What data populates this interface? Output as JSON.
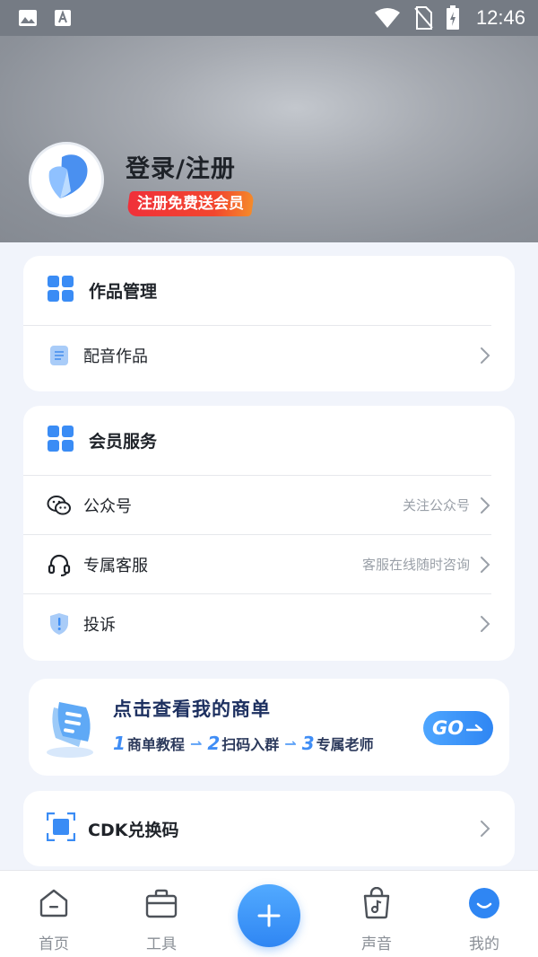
{
  "status_bar": {
    "time": "12:46",
    "icons_left": [
      "gallery-icon",
      "font-icon"
    ],
    "icons_right": [
      "wifi-icon",
      "no-sim-icon",
      "battery-charging-icon"
    ]
  },
  "profile": {
    "login_label": "登录/注册",
    "badge_label": "注册免费送会员"
  },
  "works_card": {
    "title": "作品管理",
    "items": [
      {
        "label": "配音作品",
        "hint": ""
      }
    ]
  },
  "member_card": {
    "title": "会员服务",
    "items": [
      {
        "label": "公众号",
        "hint": "关注公众号"
      },
      {
        "label": "专属客服",
        "hint": "客服在线随时咨询"
      },
      {
        "label": "投诉",
        "hint": ""
      }
    ]
  },
  "shop_banner": {
    "title": "点击查看我的商单",
    "steps": [
      {
        "num": "1",
        "label": "商单教程"
      },
      {
        "num": "2",
        "label": "扫码入群"
      },
      {
        "num": "3",
        "label": "专属老师"
      }
    ],
    "go_label": "GO"
  },
  "cdk": {
    "label": "CDK兑换码"
  },
  "bottom_nav": {
    "items": [
      {
        "label": "首页",
        "icon": "home-icon"
      },
      {
        "label": "工具",
        "icon": "toolbox-icon"
      },
      {
        "label": "声音",
        "icon": "music-bag-icon"
      },
      {
        "label": "我的",
        "icon": "profile-face-icon"
      }
    ],
    "center_icon": "plus-icon"
  },
  "colors": {
    "accent": "#2f86f3",
    "header_bg": "#8c9199",
    "badge_red": "#f0303a",
    "page_bg": "#f1f4fb"
  }
}
